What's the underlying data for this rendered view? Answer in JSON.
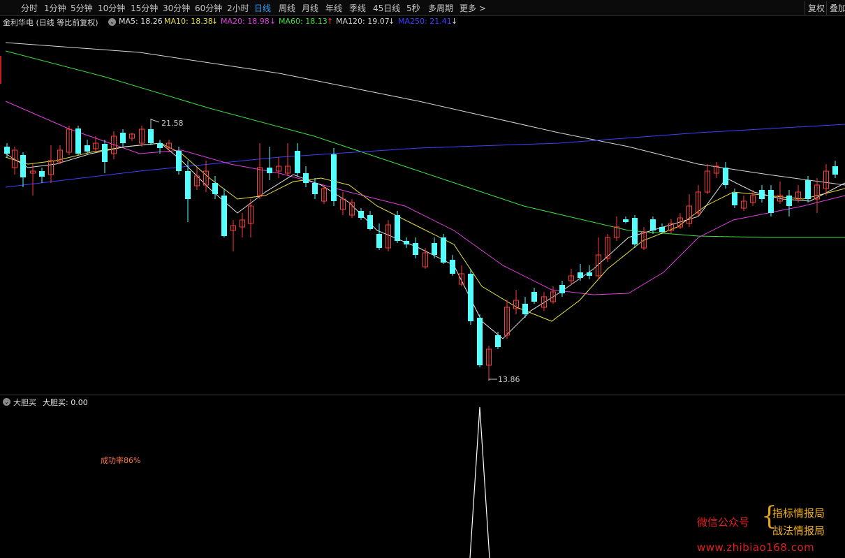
{
  "toolbar": {
    "periods": [
      "分时",
      "1分钟",
      "5分钟",
      "10分钟",
      "15分钟",
      "30分钟",
      "60分钟",
      "2小时",
      "日线",
      "周线",
      "月线",
      "年线",
      "季线",
      "45日线",
      "5秒",
      "多周期"
    ],
    "active": "日线",
    "more": "更多 >",
    "restore": "复权",
    "overlay": "叠加"
  },
  "legend": {
    "title": "金利华电 (日线 等比前复权)",
    "ma5": "MA5: 18.26",
    "ma10": "MA10: 18.38",
    "ma10_arrow": "↓",
    "ma20": "MA20: 18.98",
    "ma20_arrow": "↓",
    "ma60": "MA60: 18.13",
    "ma60_arrow": "↑",
    "ma120": "MA120: 19.07",
    "ma120_arrow": "↓",
    "ma250": "MA250: 21.41",
    "ma250_arrow": "↓",
    "colors": {
      "ma5": "#e0e0e0",
      "ma10": "#e8e040",
      "ma20": "#e040e0",
      "ma60": "#40e040",
      "ma120": "#d8d8d8",
      "ma250": "#4040ff"
    }
  },
  "chart": {
    "high_label": "21.58",
    "low_label": "13.86"
  },
  "indicator": {
    "name": "大胆买",
    "value_label": "大胆买: 0.00",
    "success_rate": "成功率86%"
  },
  "watermark": {
    "wechat": "微信公众号",
    "brace": "{",
    "name1": "指标情报局",
    "name2": "战法情报局",
    "site": "www.zhibiao168.com"
  }
}
